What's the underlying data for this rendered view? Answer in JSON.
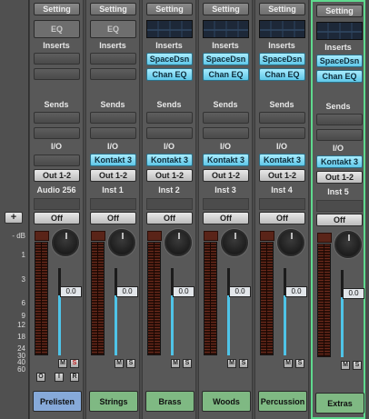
{
  "gutter": {
    "add_button_label": "+",
    "scale_header": "- dB",
    "scale": [
      "1",
      "3",
      "6",
      "9",
      "12",
      "18",
      "24",
      "30",
      "40",
      "60"
    ]
  },
  "colors": {
    "blue_button": "#5fc7e8",
    "track_label_blue": "#86a9d9",
    "track_label_green": "#7fb983",
    "selection": "#5fd98e",
    "fader": "#4fc4e8"
  },
  "strips": [
    {
      "setting": "Setting",
      "eq": "EQ",
      "eq_type": "label",
      "inserts_label": "Inserts",
      "inserts": [],
      "sends_label": "Sends",
      "io_label": "I/O",
      "input": "",
      "output": "Out 1-2",
      "track_name": "Audio 256",
      "automation": "Off",
      "gain": "0.0",
      "mute": "M",
      "solo": "S",
      "extra_buttons": [
        "O",
        "I",
        "R"
      ],
      "label": "Prelisten",
      "label_color": "#86a9d9",
      "selected": false
    },
    {
      "setting": "Setting",
      "eq": "EQ",
      "eq_type": "label",
      "inserts_label": "Inserts",
      "inserts": [],
      "sends_label": "Sends",
      "io_label": "I/O",
      "input": "Kontakt 3",
      "output": "Out 1-2",
      "track_name": "Inst 1",
      "automation": "Off",
      "gain": "0.0",
      "mute": "M",
      "solo": "S",
      "extra_buttons": [],
      "label": "Strings",
      "label_color": "#7fb983",
      "selected": false
    },
    {
      "setting": "Setting",
      "eq": "",
      "eq_type": "graph",
      "inserts_label": "Inserts",
      "inserts": [
        "SpaceDsn",
        "Chan EQ"
      ],
      "sends_label": "Sends",
      "io_label": "I/O",
      "input": "Kontakt 3",
      "output": "Out 1-2",
      "track_name": "Inst 2",
      "automation": "Off",
      "gain": "0.0",
      "mute": "M",
      "solo": "S",
      "extra_buttons": [],
      "label": "Brass",
      "label_color": "#7fb983",
      "selected": false
    },
    {
      "setting": "Setting",
      "eq": "",
      "eq_type": "graph",
      "inserts_label": "Inserts",
      "inserts": [
        "SpaceDsn",
        "Chan EQ"
      ],
      "sends_label": "Sends",
      "io_label": "I/O",
      "input": "Kontakt 3",
      "output": "Out 1-2",
      "track_name": "Inst 3",
      "automation": "Off",
      "gain": "0.0",
      "mute": "M",
      "solo": "S",
      "extra_buttons": [],
      "label": "Woods",
      "label_color": "#7fb983",
      "selected": false
    },
    {
      "setting": "Setting",
      "eq": "",
      "eq_type": "graph",
      "inserts_label": "Inserts",
      "inserts": [
        "SpaceDsn",
        "Chan EQ"
      ],
      "sends_label": "Sends",
      "io_label": "I/O",
      "input": "Kontakt 3",
      "output": "Out 1-2",
      "track_name": "Inst 4",
      "automation": "Off",
      "gain": "0.0",
      "mute": "M",
      "solo": "S",
      "extra_buttons": [],
      "label": "Percussion",
      "label_color": "#7fb983",
      "selected": false
    },
    {
      "setting": "Setting",
      "eq": "",
      "eq_type": "graph",
      "inserts_label": "Inserts",
      "inserts": [
        "SpaceDsn",
        "Chan EQ"
      ],
      "sends_label": "Sends",
      "io_label": "I/O",
      "input": "Kontakt 3",
      "output": "Out 1-2",
      "track_name": "Inst 5",
      "automation": "Off",
      "gain": "0.0",
      "mute": "M",
      "solo": "S",
      "extra_buttons": [],
      "label": "Extras",
      "label_color": "#7fb983",
      "selected": true
    }
  ]
}
